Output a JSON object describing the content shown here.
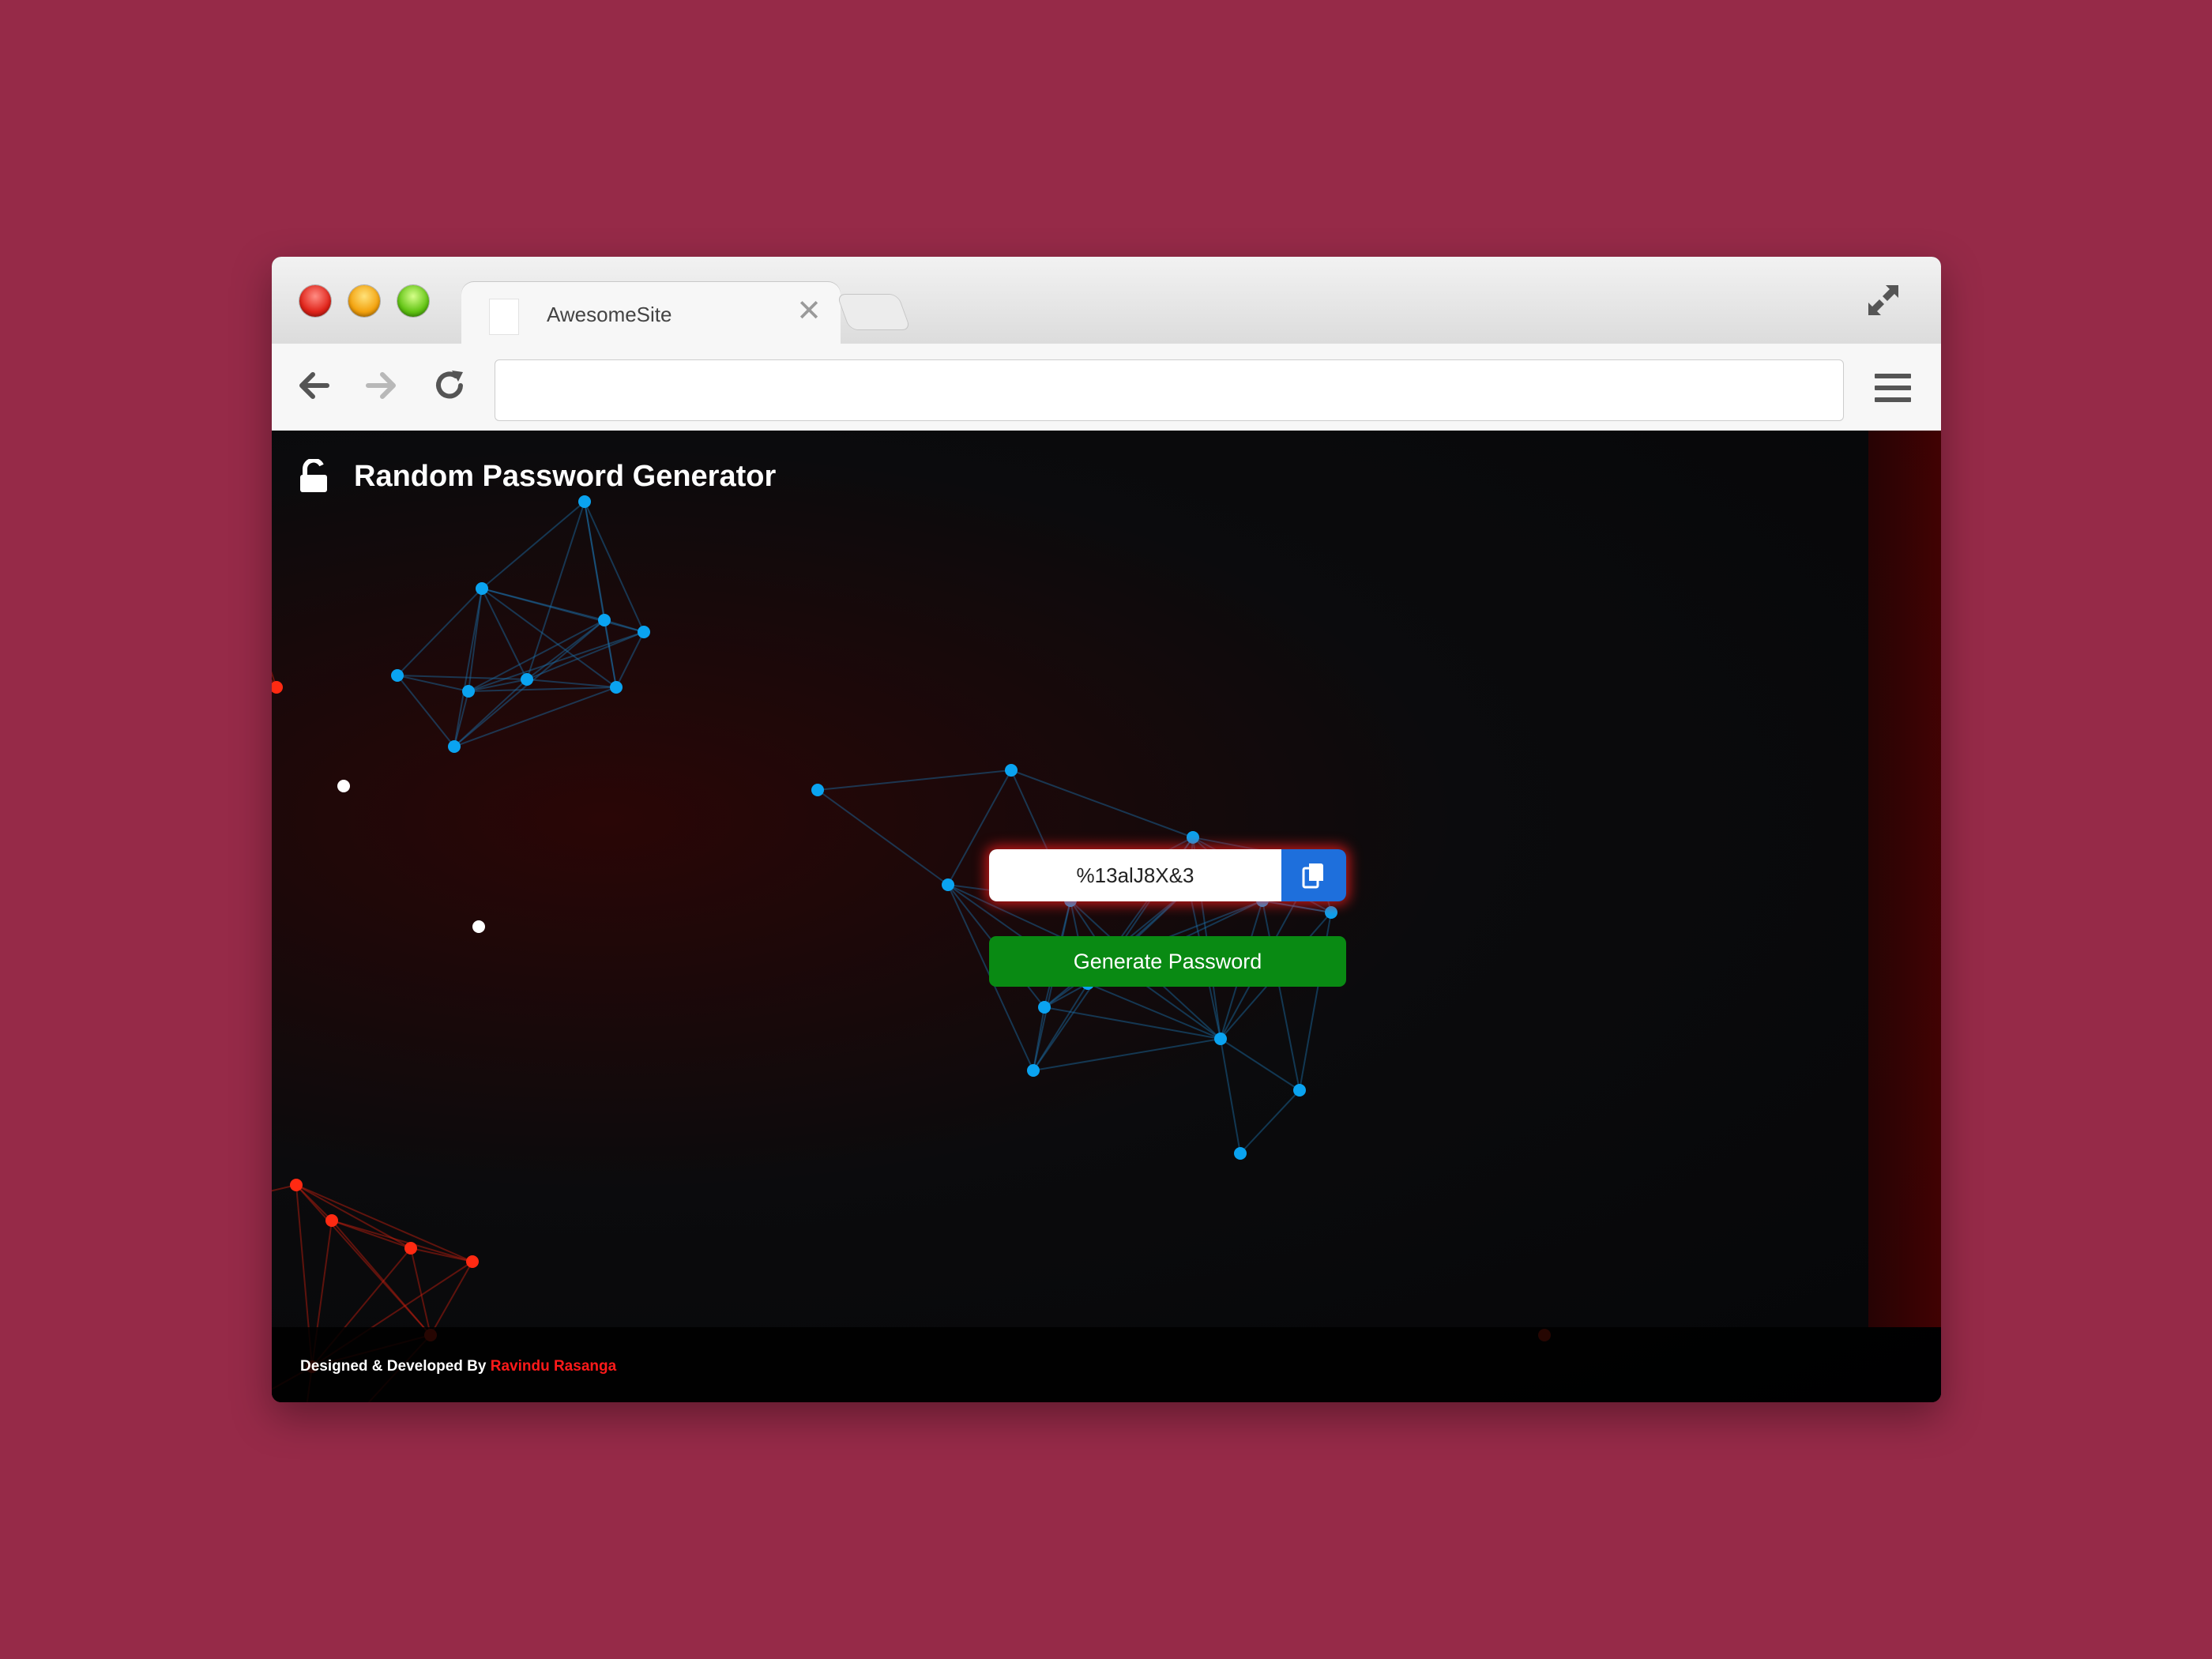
{
  "browser": {
    "tab_title": "AwesomeSite",
    "tab_close_glyph": "✕",
    "url": ""
  },
  "app": {
    "title": "Random Password Generator",
    "password_value": "%13alJ8X&3",
    "generate_label": "Generate Password",
    "footer_prefix": "Designed & Developed By ",
    "footer_author": "Ravindu Rasanga"
  },
  "colors": {
    "page_background": "#962a48",
    "accent_red": "#ff1a1a",
    "node_red": "#ff2a12",
    "node_blue": "#0aa3f0",
    "copy_button": "#1e6fdc",
    "generate_button": "#098a13"
  },
  "icons": {
    "lock": "unlock-icon",
    "copy": "copy-icon",
    "back": "arrow-left-icon",
    "forward": "arrow-right-icon",
    "reload": "reload-icon",
    "menu": "hamburger-menu-icon",
    "fullscreen": "expand-icon"
  }
}
